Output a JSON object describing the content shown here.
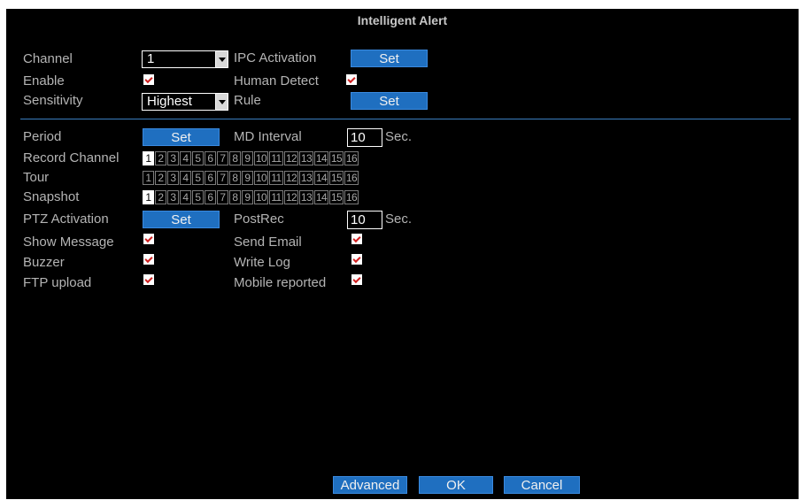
{
  "window": {
    "title": "Intelligent Alert"
  },
  "left_labels": {
    "channel": "Channel",
    "enable": "Enable",
    "sensitivity": "Sensitivity",
    "period": "Period",
    "record_channel": "Record Channel",
    "tour": "Tour",
    "snapshot": "Snapshot",
    "ptz_activation": "PTZ Activation",
    "show_message": "Show Message",
    "buzzer": "Buzzer",
    "ftp_upload": "FTP upload"
  },
  "right_labels": {
    "ipc_activation": "IPC Activation",
    "human_detect": "Human Detect",
    "rule": "Rule",
    "md_interval": "MD Interval",
    "postrec": "PostRec",
    "send_email": "Send Email",
    "write_log": "Write Log",
    "mobile_reported": "Mobile reported"
  },
  "values": {
    "channel": "1",
    "sensitivity": "Highest",
    "md_interval": "10",
    "md_interval_unit": "Sec.",
    "postrec": "10",
    "postrec_unit": "Sec."
  },
  "buttons": {
    "set_label": "Set",
    "advanced": "Advanced",
    "ok": "OK",
    "cancel": "Cancel"
  },
  "checkboxes": {
    "enable": true,
    "human_detect": true,
    "show_message": true,
    "buzzer": true,
    "ftp_upload": true,
    "send_email": true,
    "write_log": true,
    "mobile_reported": true
  },
  "channels": [
    "1",
    "2",
    "3",
    "4",
    "5",
    "6",
    "7",
    "8",
    "9",
    "10",
    "11",
    "12",
    "13",
    "14",
    "15",
    "16"
  ],
  "record_channel_selected": [
    "1"
  ],
  "tour_selected": [],
  "snapshot_selected": [
    "1"
  ],
  "colors": {
    "accent": "#1f6fc0",
    "background": "#000000",
    "divider": "#3a7ec0",
    "check": "#d02020"
  }
}
